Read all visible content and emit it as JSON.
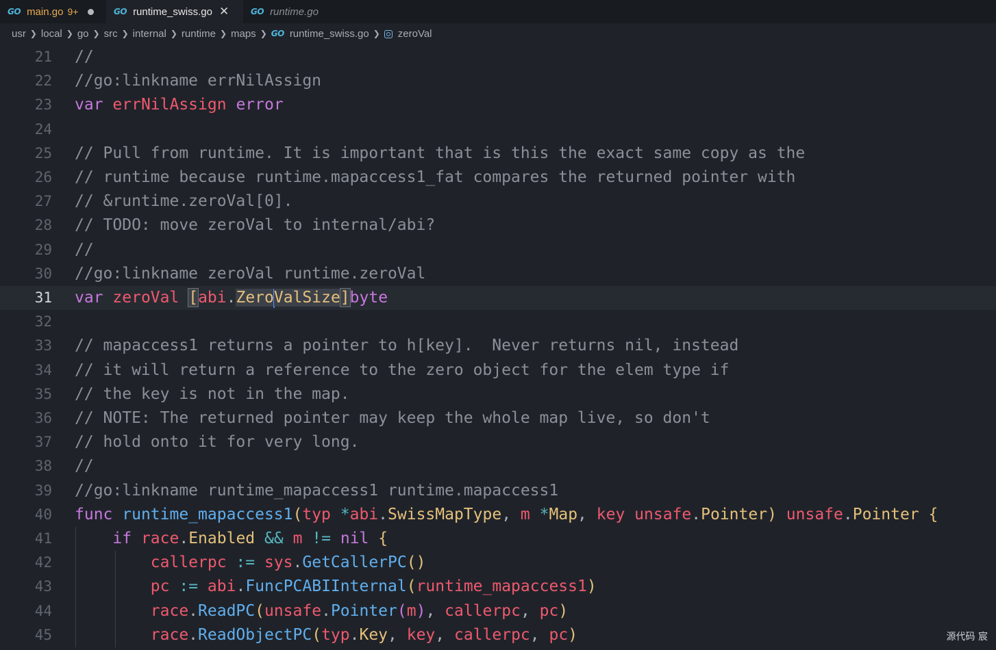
{
  "tabs": [
    {
      "label": "main.go",
      "badge": "9+",
      "icon": "go-file-icon",
      "state": "modified"
    },
    {
      "label": "runtime_swiss.go",
      "icon": "go-file-icon",
      "state": "active"
    },
    {
      "label": "runtime.go",
      "icon": "go-file-icon",
      "state": "preview"
    }
  ],
  "go_icon_text": "GO",
  "breadcrumb": [
    "usr",
    "local",
    "go",
    "src",
    "internal",
    "runtime",
    "maps",
    "runtime_swiss.go",
    "zeroVal"
  ],
  "editor": {
    "current_line": 31,
    "line_numbers": [
      "21",
      "22",
      "23",
      "24",
      "25",
      "26",
      "27",
      "28",
      "29",
      "30",
      "31",
      "32",
      "33",
      "34",
      "35",
      "36",
      "37",
      "38",
      "39",
      "40",
      "41",
      "42",
      "43",
      "44",
      "45"
    ],
    "lines": [
      "//",
      "//go:linkname errNilAssign",
      "var errNilAssign error",
      "",
      "// Pull from runtime. It is important that is this the exact same copy as the",
      "// runtime because runtime.mapaccess1_fat compares the returned pointer with",
      "// &runtime.zeroVal[0].",
      "// TODO: move zeroVal to internal/abi?",
      "//",
      "//go:linkname zeroVal runtime.zeroVal",
      "var zeroVal [abi.ZeroValSize]byte",
      "",
      "// mapaccess1 returns a pointer to h[key].  Never returns nil, instead",
      "// it will return a reference to the zero object for the elem type if",
      "// the key is not in the map.",
      "// NOTE: The returned pointer may keep the whole map live, so don't",
      "// hold onto it for very long.",
      "//",
      "//go:linkname runtime_mapaccess1 runtime.mapaccess1",
      "func runtime_mapaccess1(typ *abi.SwissMapType, m *Map, key unsafe.Pointer) unsafe.Pointer {",
      "    if race.Enabled && m != nil {",
      "        callerpc := sys.GetCallerPC()",
      "        pc := abi.FuncPCABIInternal(runtime_mapaccess1)",
      "        race.ReadPC(unsafe.Pointer(m), callerpc, pc)",
      "        race.ReadObjectPC(typ.Key, key, callerpc, pc)"
    ]
  },
  "status": {
    "text": "源代码  宸"
  },
  "colors": {
    "background": "#1f2329",
    "tabbar": "#181b20",
    "comment": "#8b9098",
    "keyword": "#c678dd",
    "variable": "#ef596f",
    "function": "#61afef",
    "type": "#e5c07b",
    "go_icon": "#4fb3d9",
    "modified_tab": "#e8ab53"
  }
}
